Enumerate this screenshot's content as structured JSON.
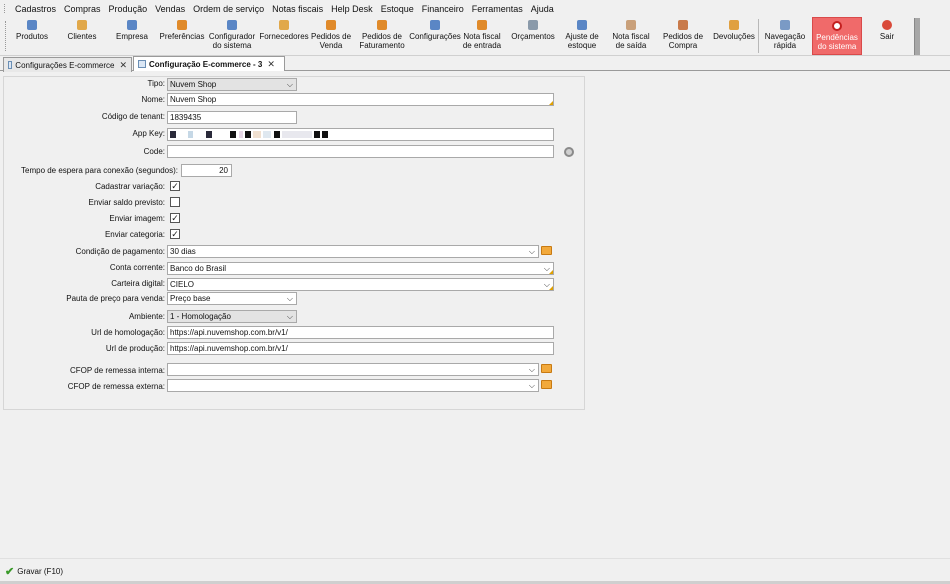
{
  "menu": [
    "Cadastros",
    "Compras",
    "Produção",
    "Vendas",
    "Ordem de serviço",
    "Notas fiscais",
    "Help Desk",
    "Estoque",
    "Financeiro",
    "Ferramentas",
    "Ajuda"
  ],
  "toolbar": [
    {
      "label": "Produtos",
      "icon": "products-icon",
      "color": "#5a86c5"
    },
    {
      "label": "Clientes",
      "icon": "customers-icon",
      "color": "#e1a84a"
    },
    {
      "label": "Empresa",
      "icon": "company-icon",
      "color": "#5a86c5"
    },
    {
      "label": "Preferências",
      "icon": "preferences-icon",
      "color": "#e08a2a"
    },
    {
      "label": "Configurador\ndo sistema",
      "icon": "system-config-icon",
      "color": "#5a86c5"
    },
    {
      "label": "Fornecedores",
      "icon": "suppliers-icon",
      "color": "#e1a84a"
    },
    {
      "label": "Pedidos de\nVenda",
      "icon": "sales-orders-icon",
      "color": "#e08a2a"
    },
    {
      "label": "Pedidos de\nFaturamento",
      "icon": "billing-orders-icon",
      "color": "#e08a2a"
    },
    {
      "label": "Configurações",
      "icon": "settings-icon",
      "color": "#5a86c5"
    },
    {
      "label": "Nota fiscal\nde entrada",
      "icon": "invoice-in-icon",
      "color": "#e08a2a"
    },
    {
      "label": "Orçamentos",
      "icon": "quotes-icon",
      "color": "#8a9aaa"
    },
    {
      "label": "Ajuste de\nestoque",
      "icon": "stock-adjust-icon",
      "color": "#5a86c5"
    },
    {
      "label": "Nota fiscal\nde saída",
      "icon": "invoice-out-icon",
      "color": "#c9a07a"
    },
    {
      "label": "Pedidos de\nCompra",
      "icon": "purchase-orders-icon",
      "color": "#c97a4a"
    },
    {
      "label": "Devoluções",
      "icon": "returns-icon",
      "color": "#e0a040"
    },
    {
      "label": "Navegação\nrápida",
      "icon": "quick-nav-icon",
      "color": "#7a9ac5"
    },
    {
      "label": "Pendências\ndo sistema",
      "icon": "pending-alert-icon",
      "color": "#ffffff"
    },
    {
      "label": "Sair",
      "icon": "exit-icon",
      "color": "#d94a3a"
    }
  ],
  "tabs": [
    {
      "label": "Configurações E-commerce",
      "close": "✕"
    },
    {
      "label": "Configuração E-commerce - 3",
      "close": "✕"
    }
  ],
  "form": {
    "tipo": {
      "label": "Tipo:",
      "value": "Nuvem Shop"
    },
    "nome": {
      "label": "Nome:",
      "value": "Nuvem Shop"
    },
    "tenant": {
      "label": "Código de tenant:",
      "value": "1839435"
    },
    "appkey": {
      "label": "App Key:"
    },
    "code": {
      "label": "Code:",
      "value": ""
    },
    "timeout": {
      "label": "Tempo de espera para conexão (segundos):",
      "value": "20"
    },
    "cadastrar_variacao": {
      "label": "Cadastrar variação:",
      "checked": "✓"
    },
    "enviar_saldo": {
      "label": "Enviar saldo previsto:",
      "checked": ""
    },
    "enviar_imagem": {
      "label": "Enviar imagem:",
      "checked": "✓"
    },
    "enviar_categoria": {
      "label": "Enviar categoria:",
      "checked": "✓"
    },
    "condicao_pagamento": {
      "label": "Condição de pagamento:",
      "value": "30 dias"
    },
    "conta_corrente": {
      "label": "Conta corrente:",
      "value": "Banco do Brasil"
    },
    "carteira_digital": {
      "label": "Carteira digital:",
      "value": "CIELO"
    },
    "pauta_preco": {
      "label": "Pauta de preço para venda:",
      "value": "Preço base"
    },
    "ambiente": {
      "label": "Ambiente:",
      "value": "1 - Homologação"
    },
    "url_homologacao": {
      "label": "Url de homologação:",
      "value": "https://api.nuvemshop.com.br/v1/"
    },
    "url_producao": {
      "label": "Url de produção:",
      "value": "https://api.nuvemshop.com.br/v1/"
    },
    "cfop_interna": {
      "label": "CFOP de remessa interna:",
      "value": ""
    },
    "cfop_externa": {
      "label": "CFOP de remessa externa:",
      "value": ""
    }
  },
  "footer": {
    "save_label": "Gravar (F10)"
  }
}
